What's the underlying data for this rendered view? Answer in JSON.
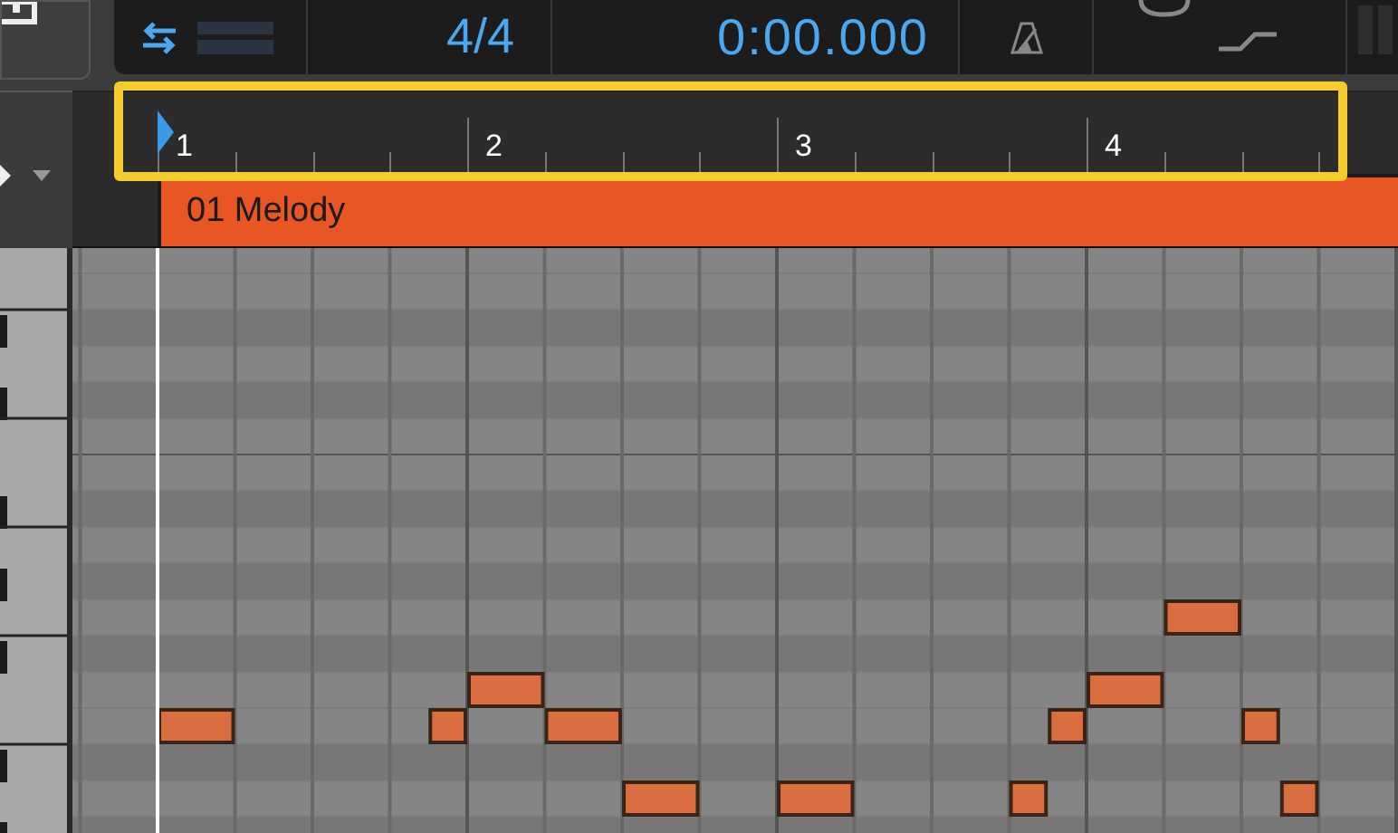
{
  "transport": {
    "time_signature": "4/4",
    "position": "0:00.000"
  },
  "ruler": {
    "highlighted": true,
    "bars": [
      "1",
      "2",
      "3",
      "4"
    ]
  },
  "clip": {
    "name": "01 Melody"
  }
}
